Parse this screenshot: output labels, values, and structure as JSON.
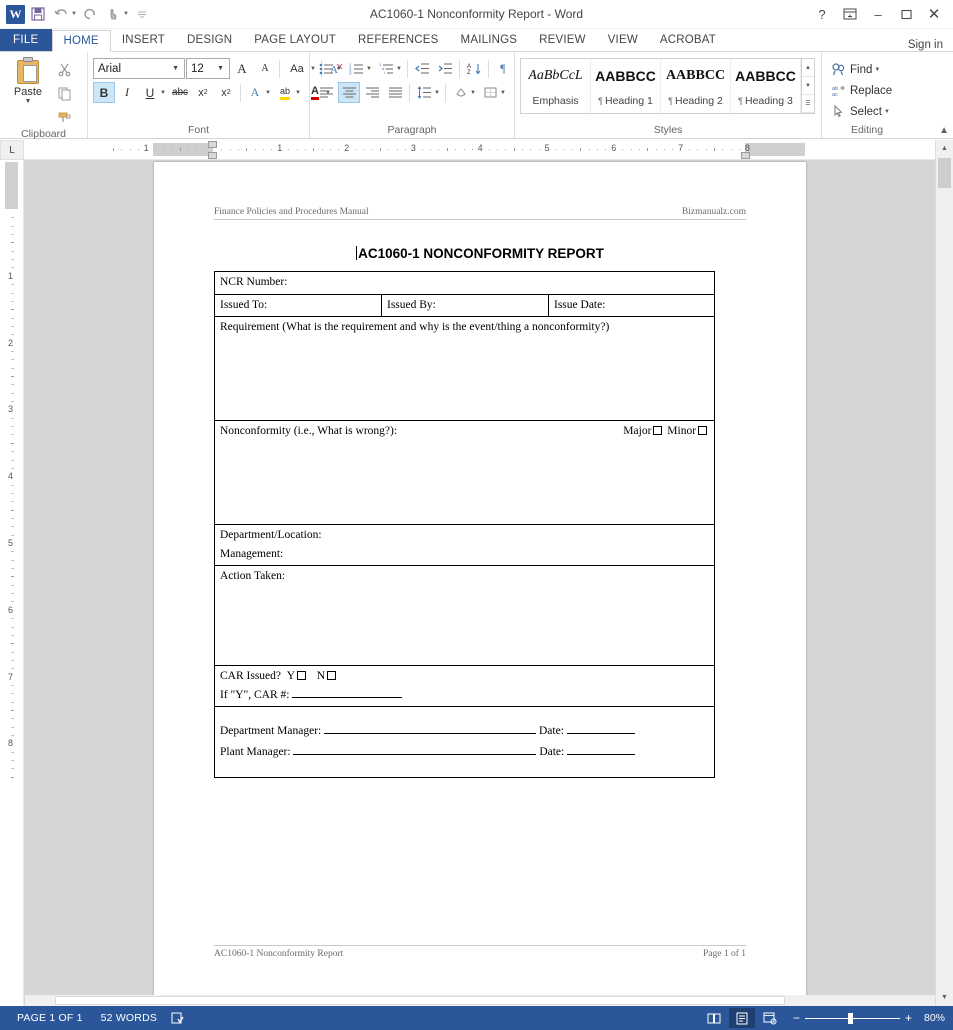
{
  "titlebar": {
    "document_title": "AC1060-1 Nonconformity Report - Word",
    "quick_access": [
      {
        "name": "word-logo",
        "label": "W"
      },
      {
        "name": "save-icon",
        "label": "Save"
      },
      {
        "name": "undo-icon",
        "label": "Undo"
      },
      {
        "name": "redo-icon",
        "label": "Redo"
      },
      {
        "name": "touch-mode-icon",
        "label": "Touch/Mouse Mode"
      },
      {
        "name": "customize-qat-icon",
        "label": "Customize Quick Access Toolbar"
      }
    ],
    "window_controls": {
      "help": "?",
      "ribbon_display": "Ribbon Display Options",
      "minimize": "–",
      "restore": "❐",
      "close": "✕"
    },
    "sign_in": "Sign in"
  },
  "tabs": [
    {
      "label": "FILE",
      "active": false,
      "file": true
    },
    {
      "label": "HOME",
      "active": true
    },
    {
      "label": "INSERT",
      "active": false
    },
    {
      "label": "DESIGN",
      "active": false
    },
    {
      "label": "PAGE LAYOUT",
      "active": false
    },
    {
      "label": "REFERENCES",
      "active": false
    },
    {
      "label": "MAILINGS",
      "active": false
    },
    {
      "label": "REVIEW",
      "active": false
    },
    {
      "label": "VIEW",
      "active": false
    },
    {
      "label": "ACROBAT",
      "active": false
    }
  ],
  "ribbon": {
    "clipboard": {
      "group_label": "Clipboard",
      "paste_label": "Paste",
      "buttons": [
        "Cut",
        "Copy",
        "Format Painter"
      ]
    },
    "font": {
      "group_label": "Font",
      "font_name": "Arial",
      "font_size": "12",
      "grow_font": "A",
      "shrink_font": "A",
      "change_case": "Aa",
      "clear_formatting": "Clear Formatting",
      "bold": "B",
      "italic": "I",
      "underline": "U",
      "strikethrough": "abc",
      "subscript": "x",
      "superscript": "x",
      "text_effects": "A",
      "highlight": "ab",
      "font_color": "A"
    },
    "paragraph": {
      "group_label": "Paragraph",
      "buttons": [
        "Bullets",
        "Numbering",
        "Multilevel List",
        "Decrease Indent",
        "Increase Indent",
        "Sort",
        "Show/Hide",
        "Align Left",
        "Center",
        "Align Right",
        "Justify",
        "Line and Paragraph Spacing",
        "Shading",
        "Borders"
      ]
    },
    "styles": {
      "group_label": "Styles",
      "items": [
        {
          "preview": "AaBbCcL",
          "name": "Emphasis",
          "pilcrow": false,
          "kind": "emph"
        },
        {
          "preview": "AABBCC",
          "name": "Heading 1",
          "pilcrow": true,
          "kind": "h1"
        },
        {
          "preview": "AABBCC",
          "name": "Heading 2",
          "pilcrow": true,
          "kind": "h2"
        },
        {
          "preview": "AABBCC",
          "name": "Heading 3",
          "pilcrow": true,
          "kind": "h3"
        }
      ]
    },
    "editing": {
      "group_label": "Editing",
      "find": "Find",
      "replace": "Replace",
      "select": "Select"
    }
  },
  "rulers": {
    "horizontal_numbers": [
      "1",
      "1",
      "2",
      "3",
      "4",
      "5",
      "6",
      "7"
    ],
    "vertical_numbers": [
      "1",
      "2",
      "3",
      "4",
      "5",
      "6",
      "7",
      "8"
    ],
    "tab_selector": "L"
  },
  "document": {
    "header_left": "Finance Policies and Procedures Manual",
    "header_right": "Bizmanualz.com",
    "title": "AC1060-1 NONCONFORMITY REPORT",
    "rows": {
      "ncr_number": "NCR Number:",
      "issued_to": "Issued To:",
      "issued_by": "Issued By:",
      "issue_date": "Issue Date:",
      "requirement": "Requirement (What is the requirement and why is the event/thing a nonconformity?)",
      "nonconformity": "Nonconformity (i.e., What is wrong?):",
      "major": "Major",
      "minor": "Minor",
      "department_location": "Department/Location:",
      "management": "Management:",
      "action_taken": "Action Taken:",
      "car_issued": "CAR Issued?",
      "car_yes": "Y",
      "car_no": "N",
      "car_number": "If \"Y\", CAR #:",
      "department_manager": "Department Manager:",
      "plant_manager": "Plant Manager:",
      "date_label_1": "Date:",
      "date_label_2": "Date:"
    },
    "footer_left": "AC1060-1 Nonconformity Report",
    "footer_right": "Page 1 of 1"
  },
  "statusbar": {
    "page_count": "PAGE 1 OF 1",
    "word_count": "52 WORDS",
    "proofing_icon": "proofing-errors-icon",
    "views": [
      {
        "name": "read-mode",
        "label": "Read Mode",
        "active": false
      },
      {
        "name": "print-layout",
        "label": "Print Layout",
        "active": true
      },
      {
        "name": "web-layout",
        "label": "Web Layout",
        "active": false
      }
    ],
    "zoom_out": "−",
    "zoom_in": "+",
    "zoom_level": "80%"
  },
  "colors": {
    "word_blue": "#2b579a",
    "accent_active_tab": "#2b579a",
    "ribbon_bg": "#ffffff",
    "workspace_gray": "#d6d6d6"
  }
}
